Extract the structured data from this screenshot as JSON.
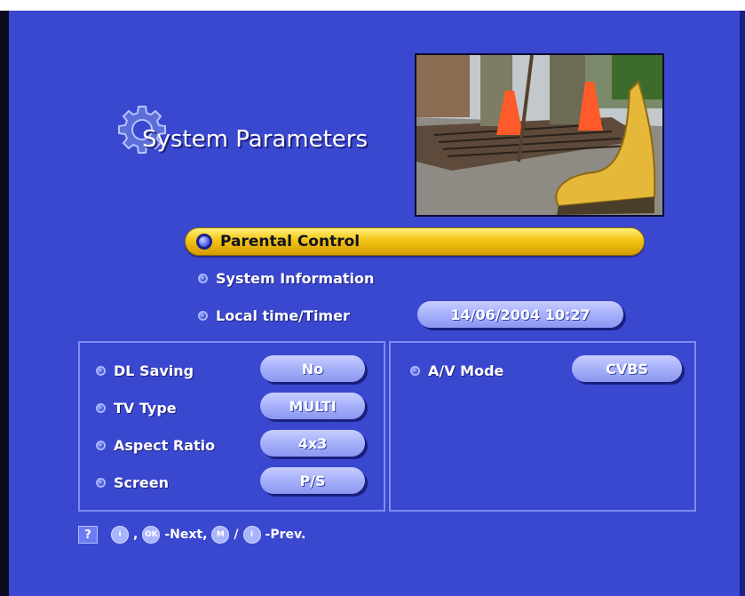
{
  "page": {
    "title": "System Parameters"
  },
  "menu": {
    "items": [
      {
        "label": "Parental Control"
      },
      {
        "label": "System Information"
      },
      {
        "label": "Local time/Timer"
      }
    ],
    "datetime": "14/06/2004 10:27"
  },
  "left_panel": {
    "rows": [
      {
        "label": "DL Saving",
        "value": "No"
      },
      {
        "label": "TV Type",
        "value": "MULTI"
      },
      {
        "label": "Aspect Ratio",
        "value": "4x3"
      },
      {
        "label": "Screen",
        "value": "P/S"
      }
    ]
  },
  "right_panel": {
    "rows": [
      {
        "label": "A/V Mode",
        "value": "CVBS"
      }
    ]
  },
  "help": {
    "q": "?",
    "key_i": "i",
    "comma": ",",
    "key_ok": "OK",
    "next": "-Next,",
    "key_m": "M",
    "slash": "/",
    "key_prev": "i",
    "prev": "-Prev."
  },
  "colors": {
    "background": "#3a47cf",
    "highlight": "#f2c514",
    "pill": "#a6b0fa"
  }
}
